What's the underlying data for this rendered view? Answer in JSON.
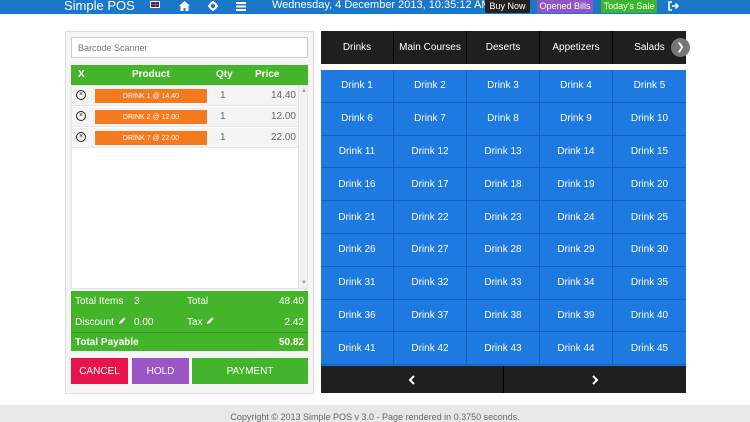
{
  "navbar": {
    "brand": "Simple POS",
    "datetime": "Wednesday, 4 December 2013, 10:35:12 AM",
    "buy_now": "Buy Now",
    "opened_bills": "Opened Bills",
    "todays_sale": "Today's Sale",
    "icons": [
      "uk-flag-icon",
      "home-icon",
      "gear-icon",
      "list-icon",
      "logout-icon"
    ]
  },
  "order": {
    "barcode_placeholder": "Barcode Scanner",
    "headers": {
      "x": "X",
      "product": "Product",
      "qty": "Qty",
      "price": "Price"
    },
    "items": [
      {
        "label": "DRINK 1 @ 14.40",
        "qty": "1",
        "price": "14.40"
      },
      {
        "label": "DRINK 2 @ 12.00",
        "qty": "1",
        "price": "12.00"
      },
      {
        "label": "DRINK 7 @ 22.00",
        "qty": "1",
        "price": "22.00"
      }
    ],
    "totals": {
      "total_items_label": "Total Items",
      "total_items": "3",
      "total_label": "Total",
      "total": "48.40",
      "discount_label": "Discount",
      "discount": "0.00",
      "tax_label": "Tax",
      "tax": "2.42",
      "payable_label": "Total Payable",
      "payable": "50.82"
    },
    "buttons": {
      "cancel": "CANCEL",
      "hold": "HOLD",
      "payment": "PAYMENT"
    }
  },
  "categories": [
    "Drinks",
    "Main Courses",
    "Deserts",
    "Appetizers",
    "Salads"
  ],
  "products": [
    "Drink 1",
    "Drink 2",
    "Drink 3",
    "Drink 4",
    "Drink 5",
    "Drink 6",
    "Drink 7",
    "Drink 8",
    "Drink 9",
    "Drink 10",
    "Drink 11",
    "Drink 12",
    "Drink 13",
    "Drink 14",
    "Drink 15",
    "Drink 16",
    "Drink 17",
    "Drink 18",
    "Drink 19",
    "Drink 20",
    "Drink 21",
    "Drink 22",
    "Drink 23",
    "Drink 24",
    "Drink 25",
    "Drink 26",
    "Drink 27",
    "Drink 28",
    "Drink 29",
    "Drink 30",
    "Drink 31",
    "Drink 32",
    "Drink 33",
    "Drink 34",
    "Drink 35",
    "Drink 36",
    "Drink 37",
    "Drink 38",
    "Drink 39",
    "Drink 40",
    "Drink 41",
    "Drink 42",
    "Drink 43",
    "Drink 44",
    "Drink 45"
  ],
  "footer": "Copyright © 2013 Simple POS v 3.0 - Page rendered in 0.3750 seconds.",
  "colors": {
    "navbar": "#1b78c8",
    "green": "#44b52a",
    "orange": "#f47a20",
    "product_blue": "#1e7ae0",
    "cancel_red": "#e8154d",
    "hold_purple": "#9b55c5"
  }
}
